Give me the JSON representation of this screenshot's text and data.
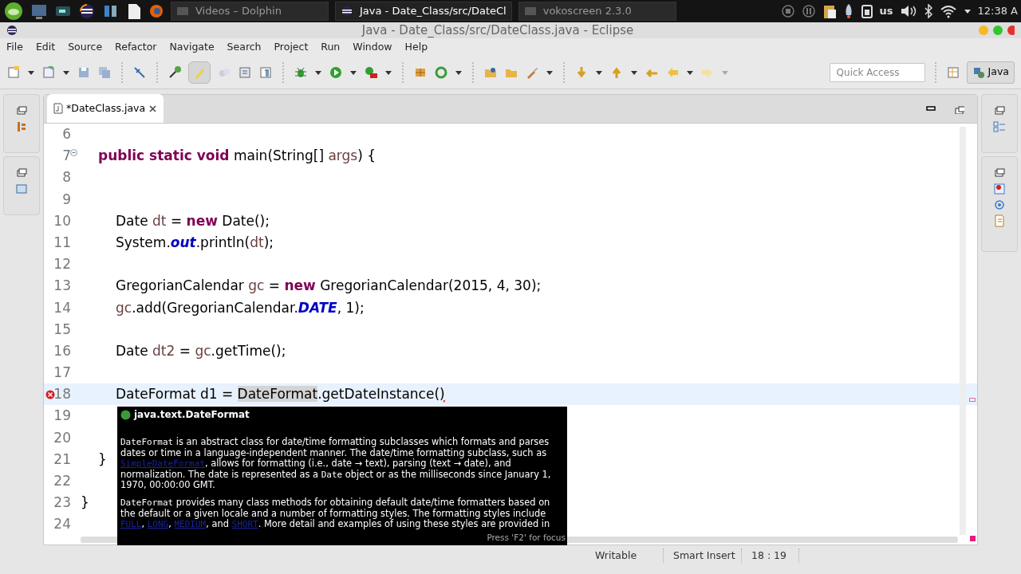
{
  "taskbar": {
    "tasks": [
      {
        "label": "Videos – Dolphin",
        "selected": false
      },
      {
        "label": "Java - Date_Class/src/DateCl",
        "selected": true
      },
      {
        "label": "vokoscreen 2.3.0",
        "selected": false
      }
    ],
    "keyboard_layout": "us",
    "clock": "12:38 A"
  },
  "window": {
    "title": "Java - Date_Class/src/DateClass.java - Eclipse"
  },
  "menu": [
    "File",
    "Edit",
    "Source",
    "Refactor",
    "Navigate",
    "Search",
    "Project",
    "Run",
    "Window",
    "Help"
  ],
  "toolbar": {
    "quick_access": {
      "placeholder": "Quick Access"
    },
    "perspective": {
      "label": "Java",
      "selected": true
    }
  },
  "editor": {
    "tabs": [
      {
        "label": "*DateClass.java",
        "selected": true
      }
    ],
    "lines": [
      {
        "number": "6",
        "current": false,
        "error": false
      },
      {
        "number": "7",
        "current": false,
        "error": false,
        "collapsible": true,
        "tokens": [
          {
            "text": "\tpublic static void",
            "kind": "kw"
          },
          {
            "text": " main(String[] ",
            "kind": "plain"
          },
          {
            "text": "args",
            "kind": "var"
          },
          {
            "text": ") {",
            "kind": "plain"
          }
        ]
      },
      {
        "number": "8",
        "current": false,
        "error": false
      },
      {
        "number": "9",
        "current": false,
        "error": false
      },
      {
        "number": "10",
        "current": false,
        "error": false,
        "tokens": [
          {
            "text": "\t\tDate ",
            "kind": "plain"
          },
          {
            "text": "dt",
            "kind": "var"
          },
          {
            "text": " = ",
            "kind": "plain"
          },
          {
            "text": "new",
            "kind": "kw"
          },
          {
            "text": " Date();",
            "kind": "plain"
          }
        ]
      },
      {
        "number": "11",
        "current": false,
        "error": false,
        "tokens": [
          {
            "text": "\t\tSystem.",
            "kind": "plain"
          },
          {
            "text": "out",
            "kind": "field"
          },
          {
            "text": ".println(",
            "kind": "plain"
          },
          {
            "text": "dt",
            "kind": "var"
          },
          {
            "text": ");",
            "kind": "plain"
          }
        ]
      },
      {
        "number": "12",
        "current": false,
        "error": false
      },
      {
        "number": "13",
        "current": false,
        "error": false,
        "tokens": [
          {
            "text": "\t\tGregorianCalendar ",
            "kind": "plain"
          },
          {
            "text": "gc",
            "kind": "var"
          },
          {
            "text": " = ",
            "kind": "plain"
          },
          {
            "text": "new",
            "kind": "kw"
          },
          {
            "text": " GregorianCalendar(2015, 4, 30);",
            "kind": "plain"
          }
        ]
      },
      {
        "number": "14",
        "current": false,
        "error": false,
        "tokens": [
          {
            "text": "\t\tgc",
            "kind": "var"
          },
          {
            "text": ".add(GregorianCalendar.",
            "kind": "plain"
          },
          {
            "text": "DATE",
            "kind": "field"
          },
          {
            "text": ", 1);",
            "kind": "plain"
          }
        ]
      },
      {
        "number": "15",
        "current": false,
        "error": false
      },
      {
        "number": "16",
        "current": false,
        "error": false,
        "tokens": [
          {
            "text": "\t\tDate ",
            "kind": "plain"
          },
          {
            "text": "dt2",
            "kind": "var"
          },
          {
            "text": " = ",
            "kind": "plain"
          },
          {
            "text": "gc",
            "kind": "var"
          },
          {
            "text": ".getTime();",
            "kind": "plain"
          }
        ]
      },
      {
        "number": "17",
        "current": false,
        "error": false
      },
      {
        "number": "18",
        "current": true,
        "error": true,
        "tokens": [
          {
            "text": "\t\tDateFormat d1 = ",
            "kind": "plain"
          },
          {
            "text": "DateFormat",
            "kind": "occurrence"
          },
          {
            "text": ".getDateInstance(",
            "kind": "plain"
          },
          {
            "text": ")",
            "kind": "error"
          }
        ]
      },
      {
        "number": "19",
        "current": false,
        "error": false
      },
      {
        "number": "20",
        "current": false,
        "error": false
      },
      {
        "number": "21",
        "current": false,
        "error": false,
        "tokens": [
          {
            "text": "\t}",
            "kind": "plain"
          }
        ]
      },
      {
        "number": "22",
        "current": false,
        "error": false
      },
      {
        "number": "23",
        "current": false,
        "error": false,
        "tokens": [
          {
            "text": "}",
            "kind": "plain"
          }
        ]
      },
      {
        "number": "24",
        "current": false,
        "error": false
      }
    ],
    "hover": {
      "title": "java.text.DateFormat",
      "paragraphs": [
        [
          {
            "text": "DateFormat",
            "kind": "code"
          },
          {
            "text": " is an abstract class for date/time formatting subclasses which formats and parses dates or time in a language-independent manner. The date/time formatting subclass, such as ",
            "kind": "text"
          },
          {
            "text": "SimpleDateFormat",
            "kind": "link"
          },
          {
            "text": ", allows for formatting (i.e., date → text), parsing (text → date), and normalization. The date is represented as a ",
            "kind": "text"
          },
          {
            "text": "Date",
            "kind": "code"
          },
          {
            "text": " object or as the milliseconds since January 1, 1970, 00:00:00 GMT.",
            "kind": "text"
          }
        ],
        [
          {
            "text": "DateFormat",
            "kind": "code"
          },
          {
            "text": " provides many class methods for obtaining default date/time formatters based on the default or a given locale and a number of formatting styles. The formatting styles include ",
            "kind": "text"
          },
          {
            "text": "FULL",
            "kind": "link"
          },
          {
            "text": ", ",
            "kind": "text"
          },
          {
            "text": "LONG",
            "kind": "link"
          },
          {
            "text": ", ",
            "kind": "text"
          },
          {
            "text": "MEDIUM",
            "kind": "link"
          },
          {
            "text": ", and ",
            "kind": "text"
          },
          {
            "text": "SHORT",
            "kind": "link"
          },
          {
            "text": ". More detail and examples of using these styles are provided in",
            "kind": "text"
          }
        ]
      ],
      "footer": "Press 'F2' for focus"
    }
  },
  "status_bar": [
    "Writable",
    "Smart Insert",
    "18 : 19"
  ]
}
